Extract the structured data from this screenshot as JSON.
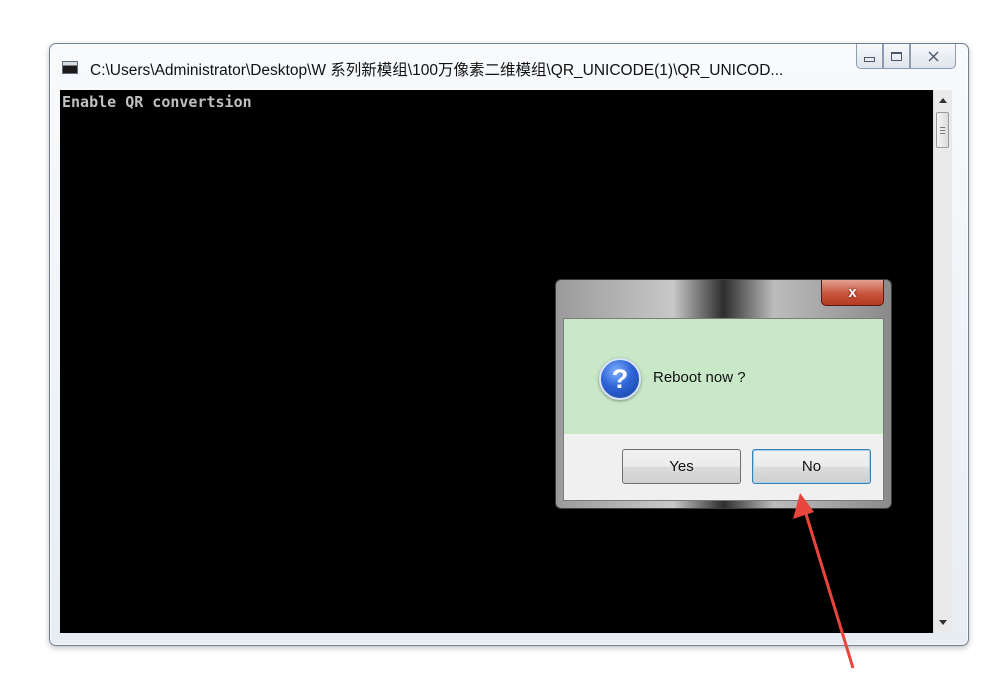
{
  "console_window": {
    "title": "C:\\Users\\Administrator\\Desktop\\W 系列新模组\\100万像素二维模组\\QR_UNICODE(1)\\QR_UNICOD...",
    "output_line": "Enable QR convertsion"
  },
  "dialog": {
    "close_glyph": "x",
    "message": "Reboot now ?",
    "icon": "question-icon",
    "yes_label": "Yes",
    "no_label": "No"
  },
  "colors": {
    "console_background": "#000000",
    "console_text": "#c0c0c0",
    "dialog_content_background": "#c8e8c8",
    "close_button": "#c8553c",
    "annotation_arrow": "#e8453c"
  }
}
